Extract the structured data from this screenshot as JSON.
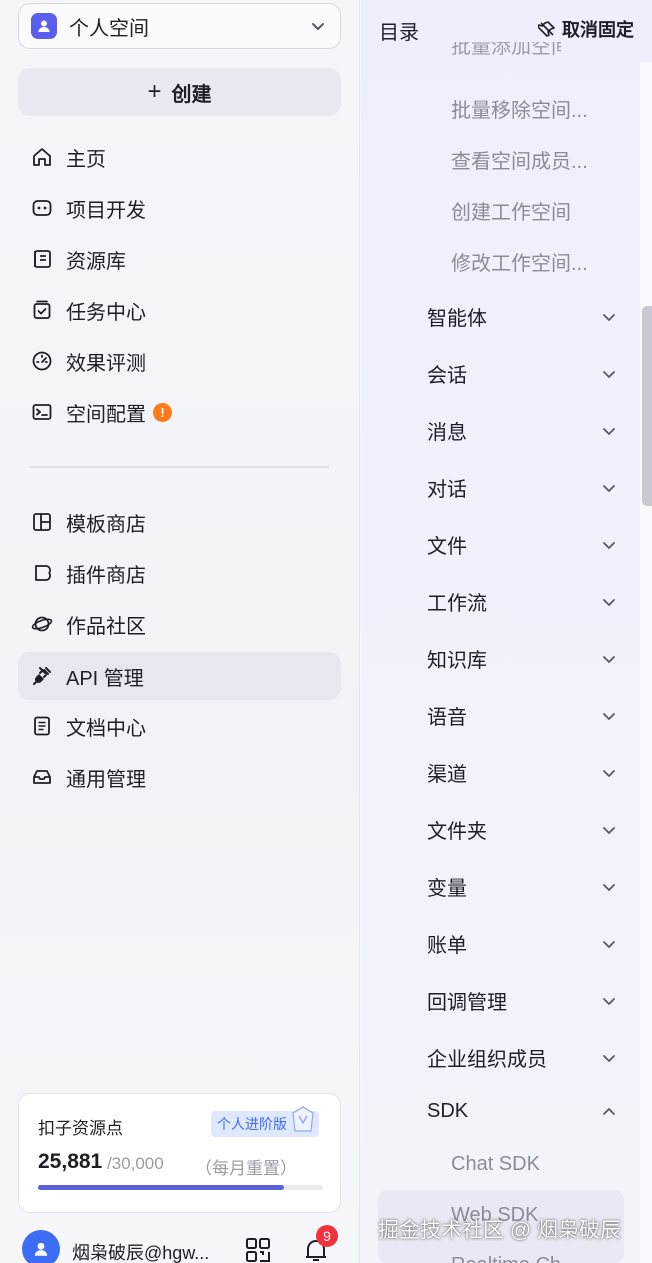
{
  "sidebar": {
    "space": {
      "label": "个人空间",
      "icon": "user-square-icon"
    },
    "create_label": "创建",
    "nav_primary": [
      {
        "label": "主页",
        "icon": "home-icon"
      },
      {
        "label": "项目开发",
        "icon": "robot-icon"
      },
      {
        "label": "资源库",
        "icon": "library-icon"
      },
      {
        "label": "任务中心",
        "icon": "task-icon"
      },
      {
        "label": "效果评测",
        "icon": "gauge-icon"
      },
      {
        "label": "空间配置",
        "icon": "terminal-icon",
        "badge": "!"
      }
    ],
    "nav_secondary": [
      {
        "label": "模板商店",
        "icon": "template-icon"
      },
      {
        "label": "插件商店",
        "icon": "plugin-icon"
      },
      {
        "label": "作品社区",
        "icon": "planet-icon"
      },
      {
        "label": "API 管理",
        "icon": "plug-icon",
        "active": true
      },
      {
        "label": "文档中心",
        "icon": "document-icon"
      },
      {
        "label": "通用管理",
        "icon": "inbox-icon"
      }
    ],
    "points": {
      "title": "扣子资源点",
      "plan": "个人进阶版",
      "value": "25,881",
      "total": "/30,000",
      "reset": "（每月重置）",
      "used_fraction": 0.863
    },
    "user": {
      "name": "烟枭破辰@hgw...",
      "notification_count": "9"
    }
  },
  "toc": {
    "title": "目录",
    "unpin_label": "取消固定",
    "cut_item": "批量添加空间",
    "sub_items": [
      "批量移除空间...",
      "查看空间成员...",
      "创建工作空间",
      "修改工作空间..."
    ],
    "sections": [
      "智能体",
      "会话",
      "消息",
      "对话",
      "文件",
      "工作流",
      "知识库",
      "语音",
      "渠道",
      "文件夹",
      "变量",
      "账单",
      "回调管理",
      "企业组织成员",
      "SDK"
    ],
    "sdk_items": [
      "Chat SDK",
      "Web SDK",
      "Realtime Ch..."
    ]
  },
  "watermark": "掘金技术社区 @ 烟枭破辰",
  "colors": {
    "accent": "#5b5fd8",
    "warning": "#ff7a1a",
    "badge": "#f0323c",
    "plan": "#3d6cf5"
  }
}
